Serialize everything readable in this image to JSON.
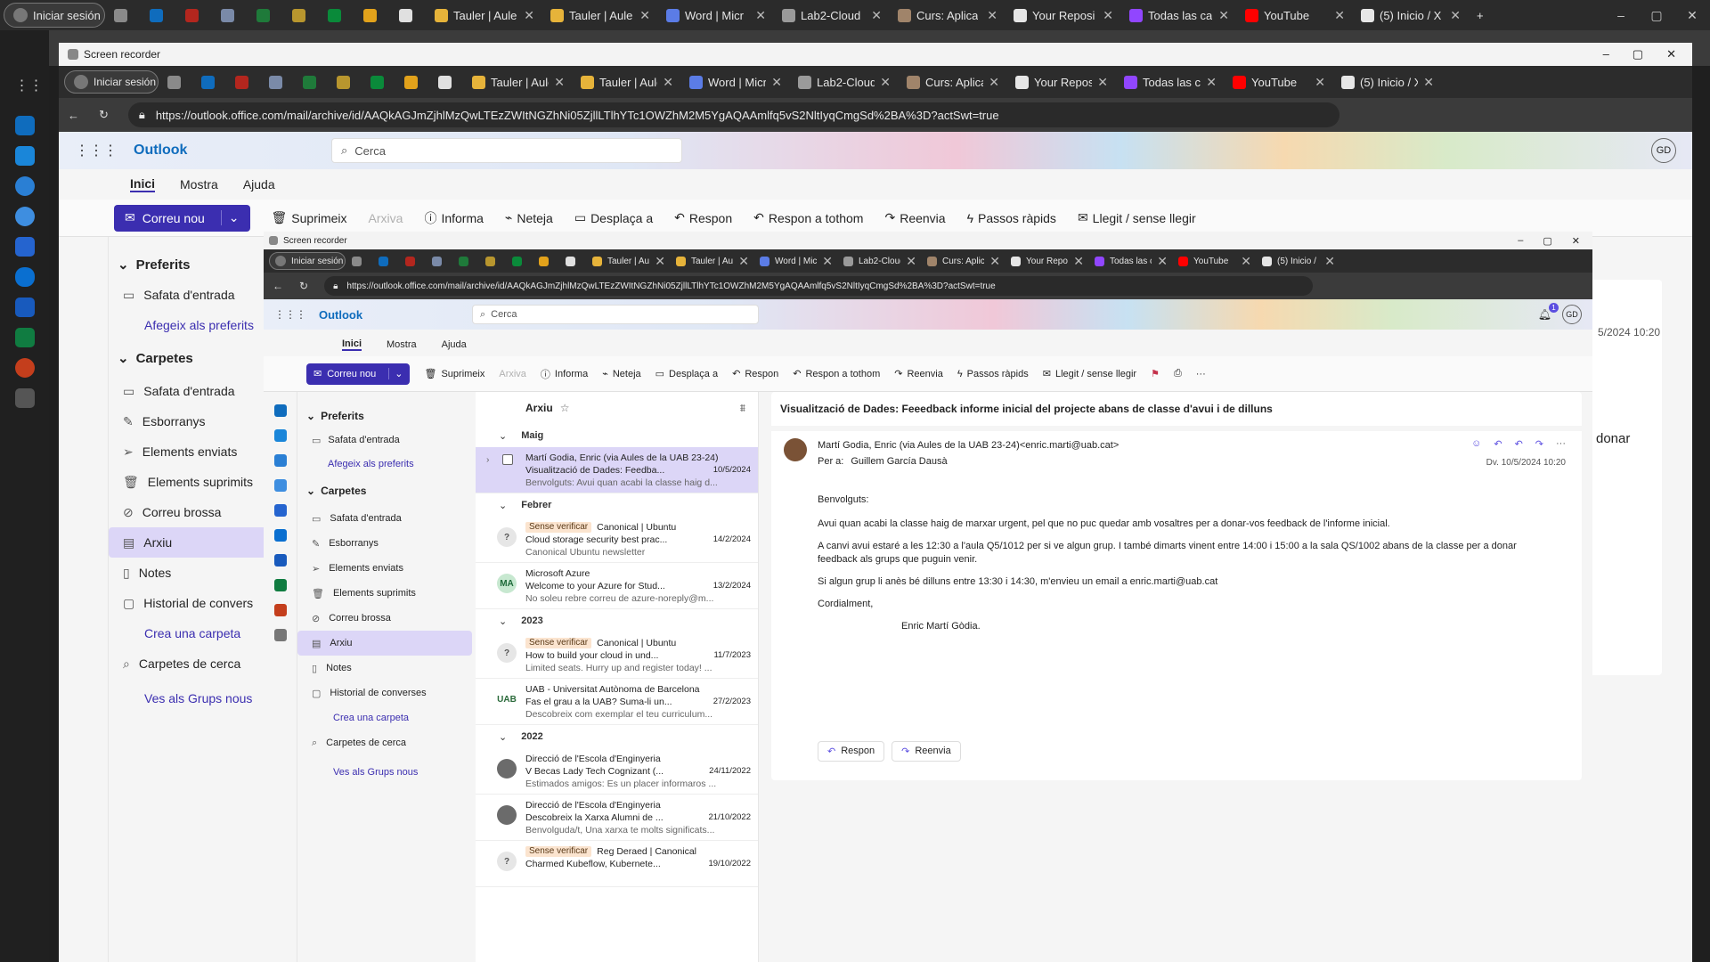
{
  "browser": {
    "profile_label": "Iniciar sesión",
    "tabs": [
      {
        "label": "",
        "icon": "copilot-tabs-icon",
        "color": "#8a8a8a"
      },
      {
        "label": "",
        "icon": "outlook-icon",
        "color": "#0f6cbd"
      },
      {
        "label": "",
        "icon": "red-app-icon",
        "color": "#b3261e"
      },
      {
        "label": "",
        "icon": "shield-icon",
        "color": "#7a8aa8"
      },
      {
        "label": "",
        "icon": "green-app-icon",
        "color": "#1f7a3a"
      },
      {
        "label": "",
        "icon": "diamond-icon",
        "color": "#b8962e"
      },
      {
        "label": "",
        "icon": "uab-icon",
        "color": "#0a8a3a"
      },
      {
        "label": "",
        "icon": "diamond-icon",
        "color": "#e2a21b"
      },
      {
        "label": "",
        "icon": "openai-icon",
        "color": "#e0e0e0"
      },
      {
        "label": "Tauler | Aule",
        "icon": "diamond-icon",
        "color": "#e6b33a"
      },
      {
        "label": "Tauler | Aule",
        "icon": "diamond-icon",
        "color": "#e6b33a"
      },
      {
        "label": "Word | Micr",
        "icon": "copilot-icon",
        "color": "#5b7ce6"
      },
      {
        "label": "Lab2-Cloud",
        "icon": "document-icon",
        "color": "#9a9a9a"
      },
      {
        "label": "Curs: Aplica",
        "icon": "diamond-icon",
        "color": "#a0846a"
      },
      {
        "label": "Your Reposi",
        "icon": "github-icon",
        "color": "#e6e6e6"
      },
      {
        "label": "Todas las ca",
        "icon": "twitch-icon",
        "color": "#9146ff"
      },
      {
        "label": "YouTube",
        "icon": "youtube-icon",
        "color": "#ff0000"
      },
      {
        "label": "(5) Inicio / X",
        "icon": "x-icon",
        "color": "#e6e6e6"
      }
    ],
    "window_title": "Screen recorder",
    "url": "https://outlook.office.com/mail/archive/id/AAQkAGJmZjhlMzQwLTEzZWItNGZhNi05ZjllLTlhYTc1OWZhM2M5YgAQAAmlfq5vS2NltIyqCmgSd%2BA%3D?actSwt=true"
  },
  "outlook": {
    "app_name": "Outlook",
    "search_placeholder": "Cerca",
    "nav_tabs": [
      "Inici",
      "Mostra",
      "Ajuda"
    ],
    "ribbon": {
      "new_mail": "Correu nou",
      "delete": "Suprimeix",
      "archive": "Arxiva",
      "report": "Informa",
      "sweep": "Neteja",
      "move": "Desplaça a",
      "reply": "Respon",
      "reply_all": "Respon a tothom",
      "forward": "Reenvia",
      "quick_steps": "Passos ràpids",
      "read_unread": "Llegit / sense llegir"
    },
    "favorites": {
      "heading": "Preferits",
      "items": [
        "Safata d'entrada"
      ],
      "add_link": "Afegeix als preferits"
    },
    "folders": {
      "heading": "Carpetes",
      "items": [
        {
          "label": "Safata d'entrada",
          "icon": "inbox-icon"
        },
        {
          "label": "Esborranys",
          "icon": "draft-icon"
        },
        {
          "label": "Elements enviats",
          "icon": "send-icon"
        },
        {
          "label": "Elements suprimits",
          "icon": "trash-icon"
        },
        {
          "label": "Correu brossa",
          "icon": "junk-icon"
        },
        {
          "label": "Arxiu",
          "icon": "archive-icon"
        },
        {
          "label": "Notes",
          "icon": "note-icon"
        },
        {
          "label": "Historial de converses",
          "icon": "folder-icon"
        }
      ],
      "outer_history_label": "Historial de convers",
      "create_link": "Crea una carpeta",
      "search_folders": "Carpetes de cerca",
      "groups_link": "Ves als Grups nous"
    },
    "list": {
      "title": "Arxiu",
      "groups": [
        {
          "label": "Maig",
          "items": [
            {
              "sender": "Martí Godia, Enric (via Aules de la UAB 23-24)",
              "subject": "Visualització de Dades: Feedba...",
              "date": "10/5/2024",
              "preview": "Benvolguts: Avui quan acabi la classe haig d...",
              "badge": "",
              "avatar": "",
              "selected": true
            }
          ]
        },
        {
          "label": "Febrer",
          "items": [
            {
              "sender": "Canonical | Ubuntu",
              "subject": "Cloud storage security best prac...",
              "date": "14/2/2024",
              "preview": "Canonical Ubuntu newsletter",
              "badge": "Sense verificar",
              "avatar": "?",
              "selected": false
            },
            {
              "sender": "Microsoft Azure",
              "subject": "Welcome to your Azure for Stud...",
              "date": "13/2/2024",
              "preview": "No soleu rebre correu de azure-noreply@m...",
              "badge": "",
              "avatar": "MA",
              "selected": false
            }
          ]
        },
        {
          "label": "2023",
          "items": [
            {
              "sender": "Canonical | Ubuntu",
              "subject": "How to build your cloud in und...",
              "date": "11/7/2023",
              "preview": "Limited seats. Hurry up and register today! ...",
              "badge": "Sense verificar",
              "avatar": "?",
              "selected": false
            },
            {
              "sender": "UAB - Universitat Autònoma de Barcelona",
              "subject": "Fas el grau a la UAB? Suma-li un...",
              "date": "27/2/2023",
              "preview": "Descobreix com exemplar el teu curriculum...",
              "badge": "",
              "avatar": "UAB",
              "selected": false
            }
          ]
        },
        {
          "label": "2022",
          "items": [
            {
              "sender": "Direcció de l'Escola d'Enginyeria",
              "subject": "V Becas Lady Tech Cognizant (...",
              "date": "24/11/2022",
              "preview": "Estimados amigos: Es un placer informaros ...",
              "badge": "",
              "avatar": "",
              "selected": false
            },
            {
              "sender": "Direcció de l'Escola d'Enginyeria",
              "subject": "Descobreix la Xarxa Alumni de ...",
              "date": "21/10/2022",
              "preview": "Benvolguda/t, Una xarxa te molts significats...",
              "badge": "",
              "avatar": "",
              "selected": false
            },
            {
              "sender": "Reg Deraed | Canonical",
              "subject": "Charmed Kubeflow, Kubernete...",
              "date": "19/10/2022",
              "preview": "",
              "badge": "Sense verificar",
              "avatar": "?",
              "selected": false
            }
          ]
        }
      ]
    },
    "reading": {
      "subject": "Visualització de Dades: Feeedback informe inicial del projecte abans de classe d'avui i de dilluns",
      "from": "Martí Godia, Enric (via Aules de la UAB 23-24)<enric.marti@uab.cat>",
      "to_label": "Per a:",
      "to": "Guillem García Dausà",
      "date": "Dv. 10/5/2024 10:20",
      "greeting": "Benvolguts:",
      "paragraphs": [
        "Avui quan acabi la classe haig de marxar urgent, pel que no puc quedar amb vosaltres per a donar-vos feedback de l'informe inicial.",
        "A canvi avui estaré a les 12:30 a l'aula Q5/1012 per si ve algun grup. I també dimarts vinent entre 14:00 i 15:00 a la sala QS/1002 abans de la classe per a donar feedback als grups que puguin venir.",
        "Si algun grup li anès bé dilluns entre 13:30 i 14:30, m'envieu un email a enric.marti@uab.cat",
        "Cordialment,"
      ],
      "signature": "Enric Martí Gòdia.",
      "reply_button": "Respon",
      "forward_button": "Reenvia",
      "outer_date_fragment": "5/2024 10:20",
      "outer_text_fragment": "donar"
    },
    "profile_initials": "GD",
    "notif_count": "1"
  }
}
